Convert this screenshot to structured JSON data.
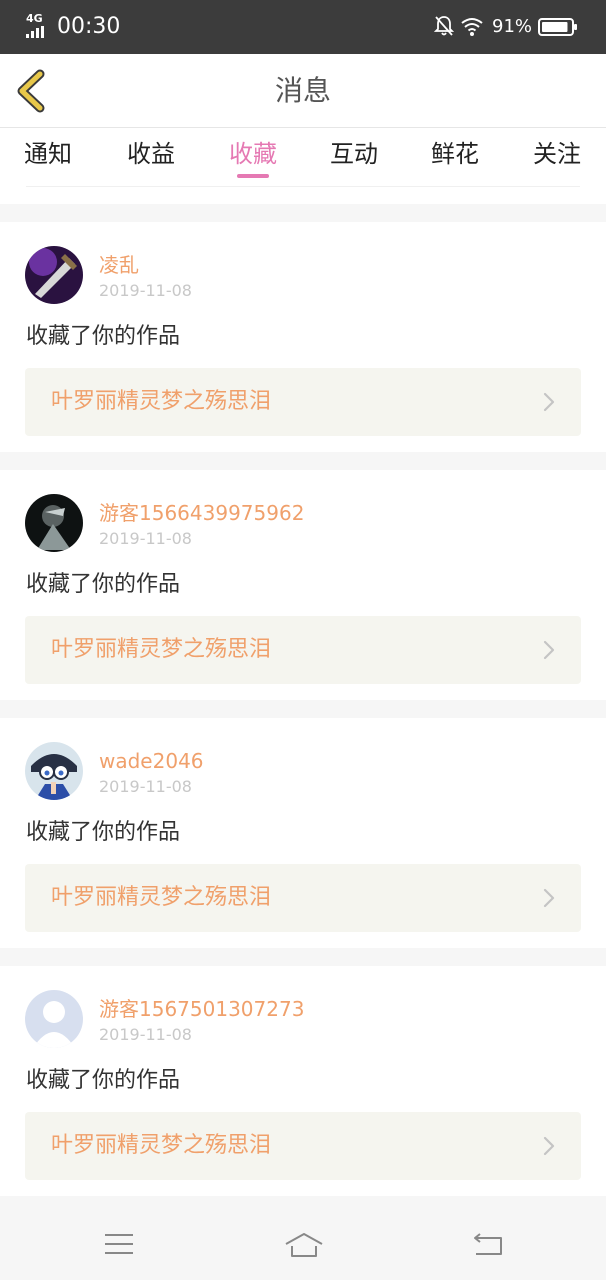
{
  "status_bar": {
    "network": "4G",
    "time": "00:30",
    "battery_percent": "91%",
    "battery_level": 0.91
  },
  "header": {
    "title": "消息"
  },
  "tabs": [
    {
      "label": "通知"
    },
    {
      "label": "收益"
    },
    {
      "label": "收藏"
    },
    {
      "label": "互动"
    },
    {
      "label": "鲜花"
    },
    {
      "label": "关注"
    }
  ],
  "active_tab": "收藏",
  "messages": [
    {
      "user": "凌乱",
      "date": "2019-11-08",
      "action": "收藏了你的作品",
      "work_title": "叶罗丽精灵梦之殇思泪"
    },
    {
      "user": "游客1566439975962",
      "date": "2019-11-08",
      "action": "收藏了你的作品",
      "work_title": "叶罗丽精灵梦之殇思泪"
    },
    {
      "user": "wade2046",
      "date": "2019-11-08",
      "action": "收藏了你的作品",
      "work_title": "叶罗丽精灵梦之殇思泪"
    },
    {
      "user": "游客1567501307273",
      "date": "2019-11-08",
      "action": "收藏了你的作品",
      "work_title": "叶罗丽精灵梦之殇思泪"
    }
  ],
  "colors": {
    "accent": "#e579b3",
    "username": "#f0a06b",
    "work_bg": "#f5f5ef",
    "back_arrow": "#e8c84a"
  },
  "icons": {
    "back": "back-arrow-icon",
    "chevron": "chevron-right-icon",
    "nav_menu": "menu-icon",
    "nav_home": "home-icon",
    "nav_back": "return-icon"
  }
}
